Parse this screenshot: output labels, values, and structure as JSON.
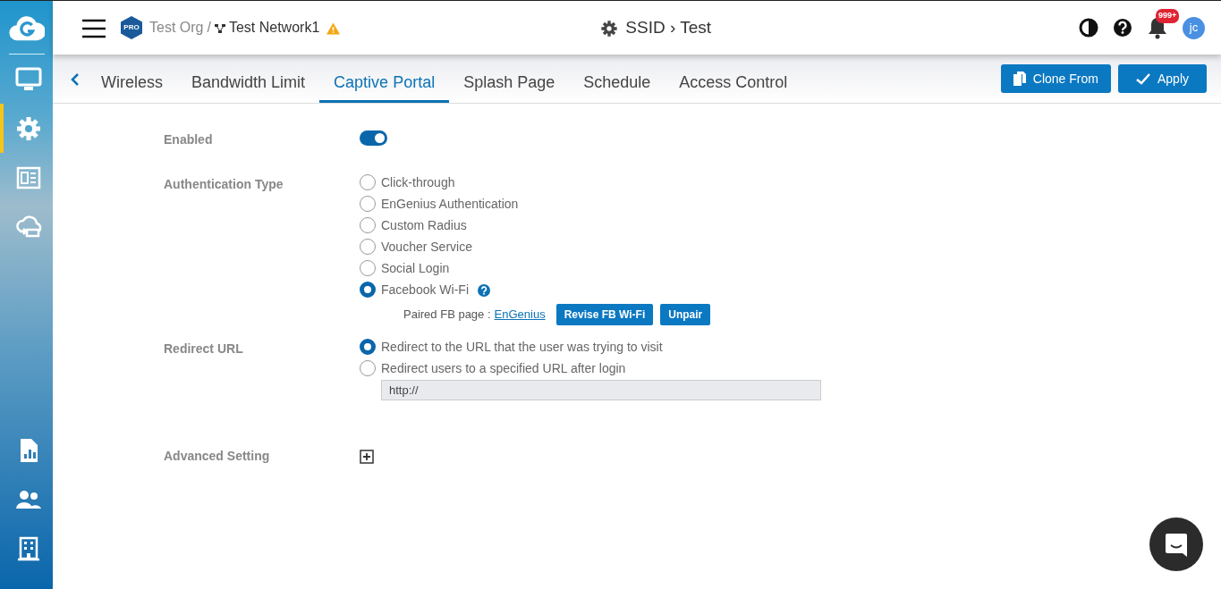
{
  "sidebar": {
    "items": [
      {
        "kind": "monitor",
        "selected": false
      },
      {
        "kind": "gear",
        "selected": true
      },
      {
        "kind": "news",
        "selected": false
      },
      {
        "kind": "cloud",
        "selected": false
      },
      {
        "kind": "report",
        "selected": false
      },
      {
        "kind": "users",
        "selected": false
      },
      {
        "kind": "building",
        "selected": false
      }
    ]
  },
  "header": {
    "badge": "PRO",
    "org": "Test Org",
    "separator": "/",
    "network": "Test Network1",
    "warning": true,
    "title": "SSID › Test",
    "notification_count": "999+",
    "avatar": "jc"
  },
  "tabs": [
    {
      "label": "Wireless",
      "selected": false
    },
    {
      "label": "Bandwidth Limit",
      "selected": false
    },
    {
      "label": "Captive Portal",
      "selected": true
    },
    {
      "label": "Splash Page",
      "selected": false
    },
    {
      "label": "Schedule",
      "selected": false
    },
    {
      "label": "Access Control",
      "selected": false
    }
  ],
  "actions": [
    {
      "kind": "clone",
      "label": "Clone From"
    },
    {
      "kind": "apply",
      "label": "Apply"
    }
  ],
  "form": {
    "enabled": {
      "label": "Enabled",
      "on": true
    },
    "auth": {
      "label": "Authentication Type",
      "options": [
        {
          "label": "Click-through",
          "selected": false,
          "help": false
        },
        {
          "label": "EnGenius Authentication",
          "selected": false,
          "help": false
        },
        {
          "label": "Custom Radius",
          "selected": false,
          "help": false
        },
        {
          "label": "Voucher Service",
          "selected": false,
          "help": false
        },
        {
          "label": "Social Login",
          "selected": false,
          "help": false
        },
        {
          "label": "Facebook Wi-Fi",
          "selected": true,
          "help": true
        }
      ],
      "paired": {
        "label": "Paired FB page :",
        "link": "EnGenius",
        "buttons": [
          "Revise FB Wi-Fi",
          "Unpair"
        ]
      }
    },
    "redirect": {
      "label": "Redirect URL",
      "options": [
        {
          "label": "Redirect to the URL that the user was trying to visit",
          "selected": true
        },
        {
          "label": "Redirect users to a specified URL after login",
          "selected": false
        }
      ],
      "url": {
        "value": "http://",
        "disabled": true
      }
    },
    "advanced": {
      "label": "Advanced Setting",
      "expanded": false
    }
  }
}
